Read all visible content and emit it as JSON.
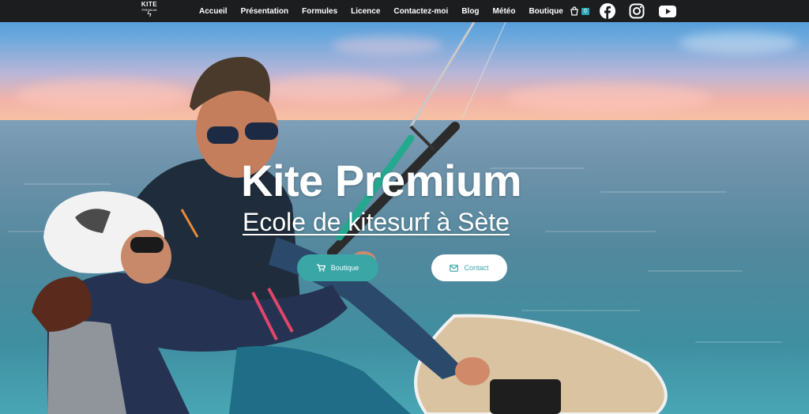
{
  "logo": {
    "word": "KITE",
    "sub": "PREMIUM"
  },
  "nav": {
    "items": [
      {
        "label": "Accueil"
      },
      {
        "label": "Présentation"
      },
      {
        "label": "Formules"
      },
      {
        "label": "Licence"
      },
      {
        "label": "Contactez-moi"
      },
      {
        "label": "Blog"
      },
      {
        "label": "Météo"
      },
      {
        "label": "Boutique"
      }
    ],
    "cart_count": "0",
    "icons": [
      "cart-icon",
      "facebook-icon",
      "instagram-icon",
      "youtube-icon"
    ]
  },
  "hero": {
    "title": "Kite Premium",
    "subtitle": "Ecole de kitesurf à Sète",
    "shop_button": "Boutique",
    "contact_button": "Contact"
  },
  "colors": {
    "topbar": "#1c1d1f",
    "accent": "#3aa6a6",
    "badge": "#2fa6b8"
  }
}
